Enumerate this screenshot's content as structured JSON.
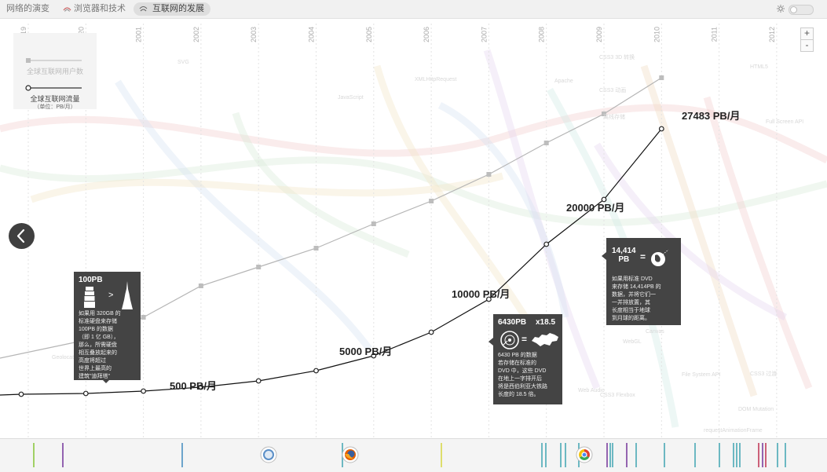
{
  "tabs": [
    {
      "label": "网络的演变",
      "icon": ""
    },
    {
      "label": "浏览器和技术",
      "icon": "browser-tech-icon"
    },
    {
      "label": "互联网的发展",
      "icon": "internet-growth-icon"
    }
  ],
  "legend": {
    "users_label": "全球互联网用户数",
    "traffic_label": "全球互联网流量",
    "traffic_unit": "（单位：PB/月）"
  },
  "zoom": {
    "in": "+",
    "out": "-"
  },
  "faint_labels": [
    "SVG",
    "XMLHttpRequest",
    "CSS3 3D 转换",
    "JavaScript",
    "Apache",
    "CSS3 动画",
    "HTML5",
    "离线存储",
    "Full Screen API",
    "CSS3 过渡",
    "File System API",
    "WebGL",
    "Web Audio",
    "DOM Mutation",
    "Geolocation",
    "CSS3 Flexbox",
    "requestAnimationFrame",
    "Canvas"
  ],
  "chart_data": {
    "type": "line",
    "title": "",
    "xlabel": "",
    "ylabel": "",
    "x": [
      "19",
      "20",
      "2001",
      "2002",
      "2003",
      "2004",
      "2005",
      "2006",
      "2007",
      "2008",
      "2009",
      "2010",
      "2011",
      "2012"
    ],
    "series": [
      {
        "name": "全球互联网用户数",
        "marker": "square",
        "color": "#b5b5b5"
      },
      {
        "name": "全球互联网流量",
        "marker": "circle",
        "color": "#111111"
      }
    ],
    "annotations": [
      "500 PB/月",
      "5000 PB/月",
      "10000 PB/月",
      "20000 PB/月",
      "27483 PB/月"
    ]
  },
  "cards": [
    {
      "head": "100PB",
      "arrow": ">",
      "body": "如果用 320GB 的\n标准硬盘来存储\n100PB 的数据\n（即 1 亿 GB），\n那么，所需硬盘\n相互叠放起来的\n高度将超过\n世界上最高的\n建筑\"迪拜塔\""
    },
    {
      "head": "6430PB",
      "multiplier": "x18.5",
      "eq": "=",
      "body": "6430 PB 的数据\n若存储在标准的\nDVD 中，这些 DVD\n在地上一字排开后\n将是西伯利亚大铁路\n长度的 18.5 倍。"
    },
    {
      "head": "14,414\nPB",
      "eq": "=",
      "body": "如果用标准 DVD\n来存储 14,414PB 的\n数据，并将它们一\n一并排放置，其\n长度相当于地球\n到月球的距离。"
    }
  ]
}
